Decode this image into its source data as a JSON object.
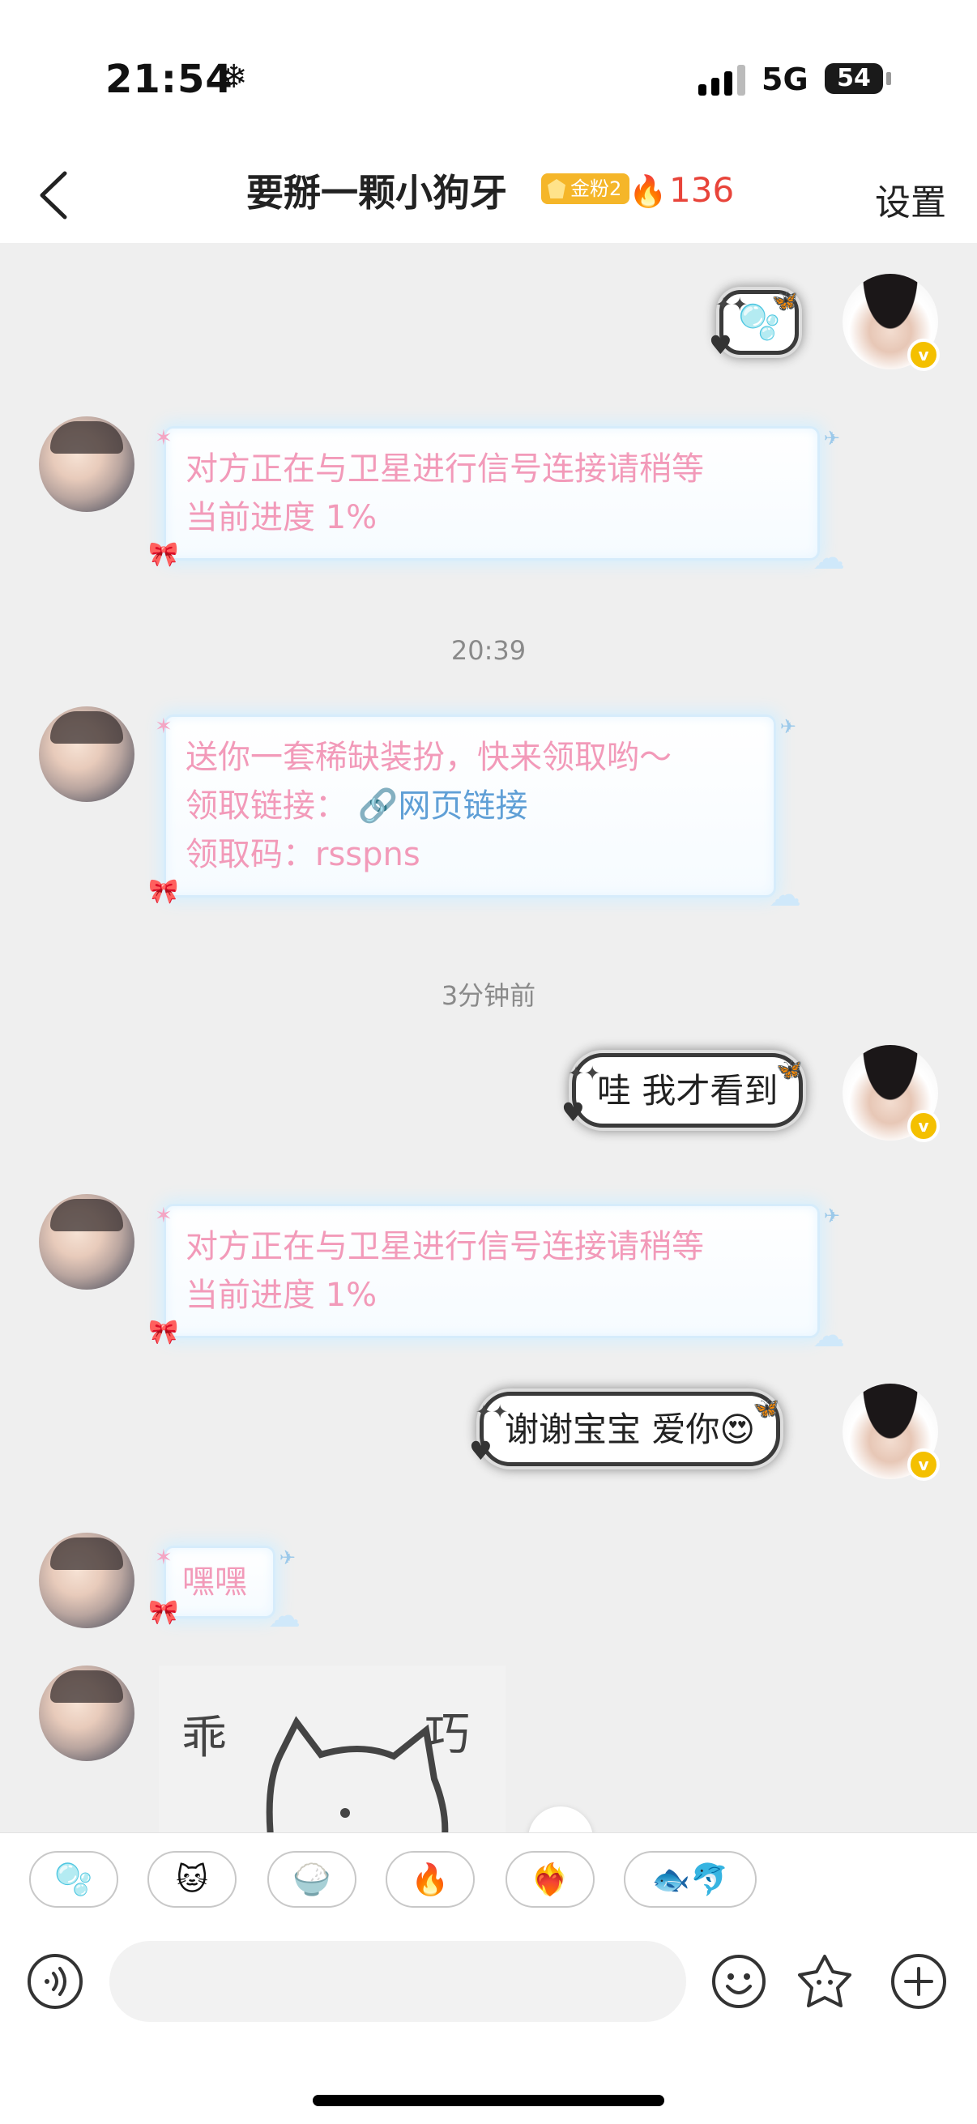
{
  "status_bar": {
    "time": "21:54",
    "time_icon": "snowflake-icon",
    "network": "5G",
    "battery": "54"
  },
  "header": {
    "title": "要掰一颗小狗牙",
    "fan_badge": "金粉2",
    "fire_count": "136",
    "settings_label": "设置"
  },
  "messages": [
    {
      "from": "me",
      "type": "sticker-bubble",
      "text": "🫧"
    },
    {
      "from": "other",
      "lines": [
        "对方正在与卫星进行信号连接请稍等",
        "当前进度 1%"
      ]
    },
    {
      "type": "time",
      "text": "20:39"
    },
    {
      "from": "other",
      "lines": [
        "送你一套稀缺装扮，快来领取哟～",
        "领取链接：",
        "网页链接",
        "领取码：rsspns"
      ]
    },
    {
      "type": "time",
      "text": "3分钟前"
    },
    {
      "from": "me",
      "text": "哇 我才看到"
    },
    {
      "from": "other",
      "lines": [
        "对方正在与卫星进行信号连接请稍等",
        "当前进度 1%"
      ]
    },
    {
      "from": "me",
      "text": "谢谢宝宝 爱你😍"
    },
    {
      "from": "other",
      "text": "嘿嘿"
    },
    {
      "from": "other",
      "type": "image",
      "sticker_text": [
        "乖",
        "巧"
      ]
    }
  ],
  "quick_reactions": [
    "🫧",
    "🐱",
    "🍚",
    "🔥",
    "❤️‍🔥",
    "🐟🐬"
  ],
  "input": {
    "placeholder": ""
  },
  "colors": {
    "accent_red": "#e8443a",
    "pink_text": "#f29ab9",
    "link_blue": "#5f9fd6",
    "badge_gold": "#f5b629"
  }
}
